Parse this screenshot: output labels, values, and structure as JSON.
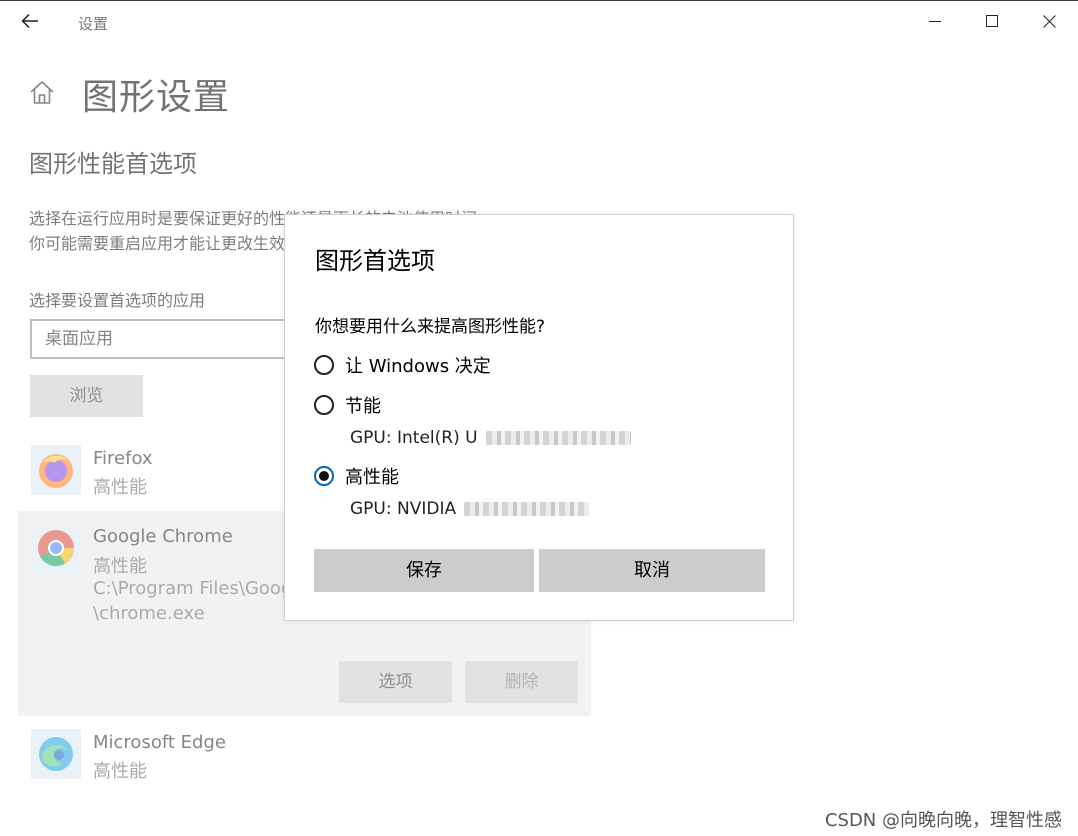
{
  "window": {
    "title": "设置"
  },
  "page": {
    "title": "图形设置",
    "section_title": "图形性能首选项",
    "description_lines": [
      "选择在运行应用时是要保证更好的性能还是更长的电池使用时间。",
      "你可能需要重启应用才能让更改生效。"
    ],
    "app_select_label": "选择要设置首选项的应用",
    "app_select_value": "桌面应用",
    "browse_label": "浏览",
    "apps": [
      {
        "name": "Firefox",
        "preference": "高性能"
      },
      {
        "name": "Google Chrome",
        "preference": "高性能",
        "path_line1": "C:\\Program Files\\Googl",
        "path_line2": "\\chrome.exe",
        "options_label": "选项",
        "delete_label": "删除"
      },
      {
        "name": "Microsoft Edge",
        "preference": "高性能"
      }
    ]
  },
  "dialog": {
    "title": "图形首选项",
    "question": "你想要用什么来提高图形性能?",
    "options": [
      {
        "label": "让 Windows 决定",
        "checked": false
      },
      {
        "label": "节能",
        "gpu": "GPU: Intel(R) U",
        "checked": false
      },
      {
        "label": "高性能",
        "gpu": "GPU: NVIDIA",
        "checked": true
      }
    ],
    "save_label": "保存",
    "cancel_label": "取消"
  },
  "watermark": "CSDN @向晚向晚，理智性感"
}
